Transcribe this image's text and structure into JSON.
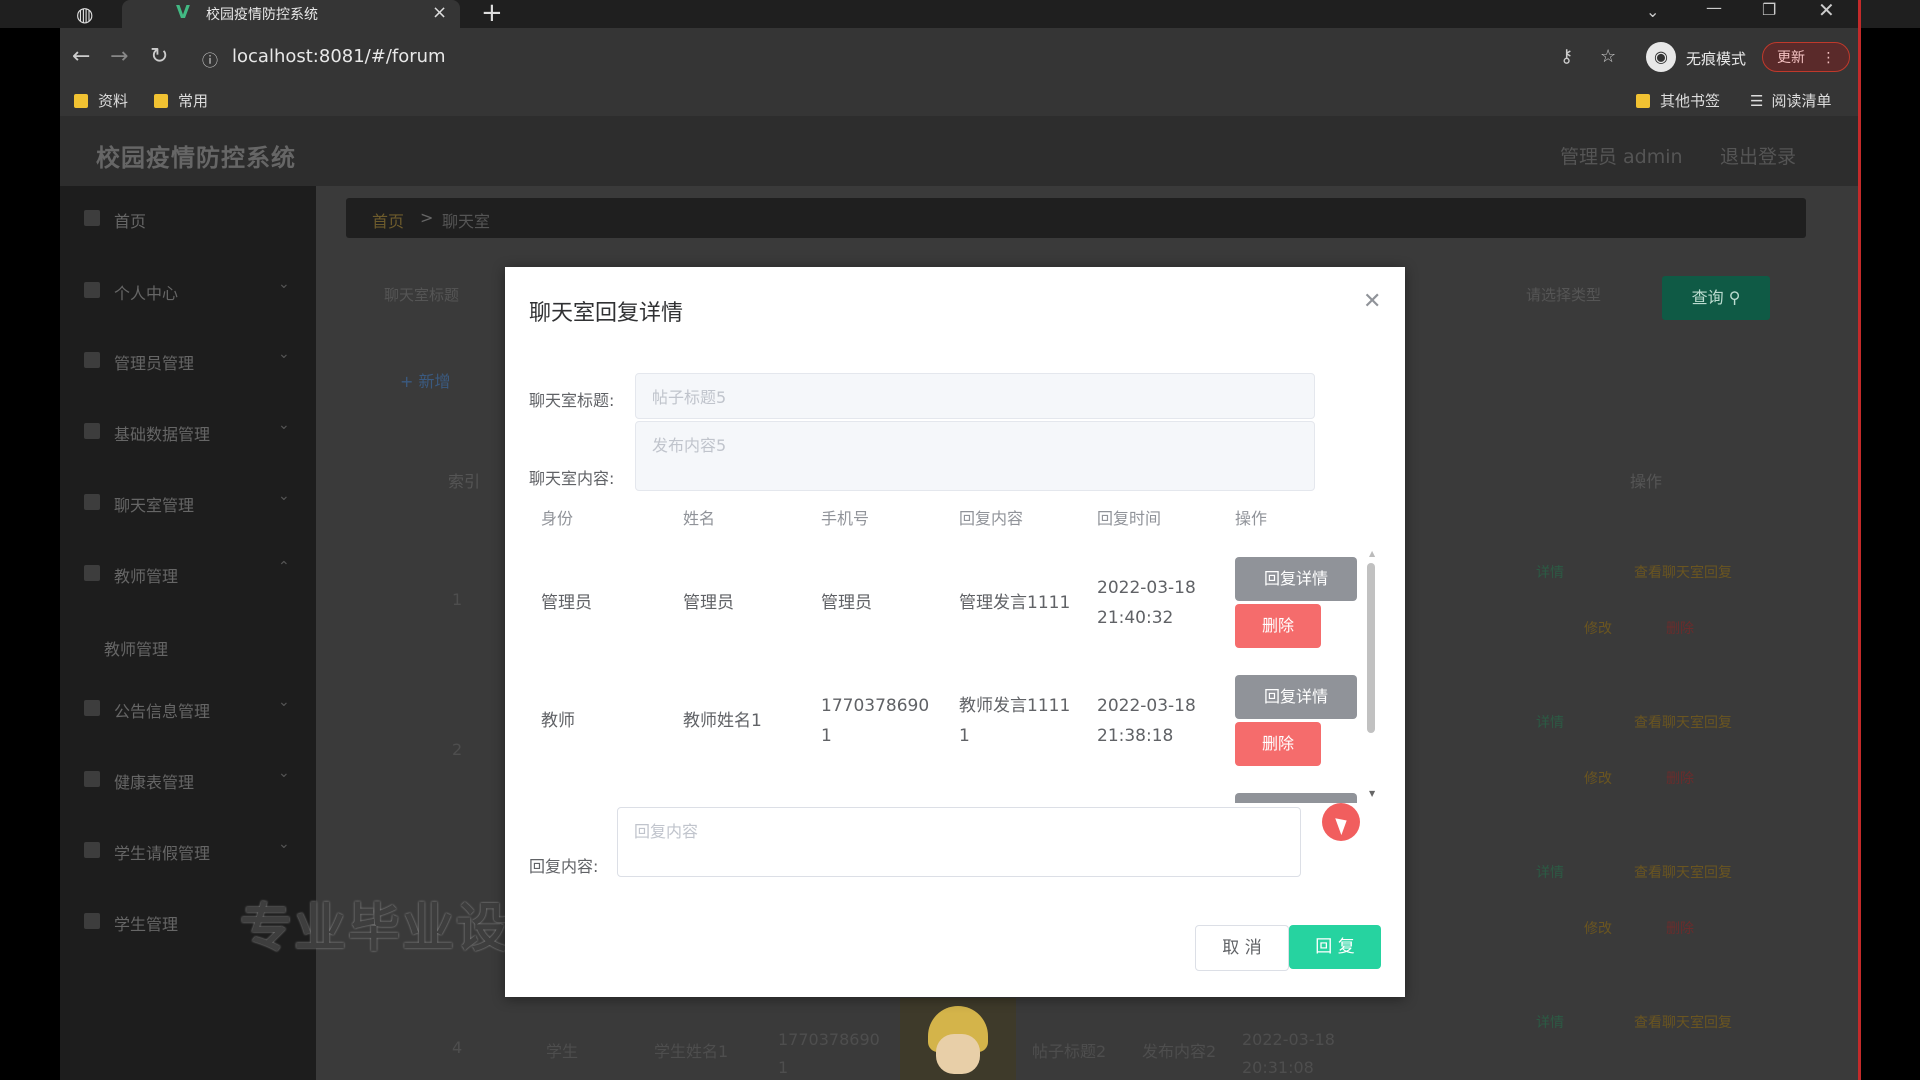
{
  "browser": {
    "tab_title": "校园疫情防控系统",
    "url": "localhost:8081/#/forum",
    "incognito_label": "无痕模式",
    "update_label": "更新",
    "bookmarks": [
      "资料",
      "常用"
    ],
    "other_bookmarks": "其他书签",
    "reading_list": "阅读清单"
  },
  "app": {
    "title": "校园疫情防控系统",
    "user": "管理员 admin",
    "logout": "退出登录"
  },
  "sidebar": {
    "items": [
      {
        "label": "首页",
        "icon": "home-icon",
        "chevron": false
      },
      {
        "label": "个人中心",
        "icon": "user-icon",
        "chevron": true
      },
      {
        "label": "管理员管理",
        "icon": "flag-icon",
        "chevron": true
      },
      {
        "label": "基础数据管理",
        "icon": "send-icon",
        "chevron": true
      },
      {
        "label": "聊天室管理",
        "icon": "chat-icon",
        "chevron": true
      },
      {
        "label": "教师管理",
        "icon": "teacher-icon",
        "chevron": true
      },
      {
        "label": "公告信息管理",
        "icon": "notice-icon",
        "chevron": true
      },
      {
        "label": "健康表管理",
        "icon": "grid-icon",
        "chevron": true
      },
      {
        "label": "学生请假管理",
        "icon": "location-icon",
        "chevron": true
      },
      {
        "label": "学生管理",
        "icon": "student-icon",
        "chevron": false
      }
    ],
    "sub_item": "教师管理"
  },
  "breadcrumb": {
    "home": "首页",
    "separator": ">",
    "current": "聊天室"
  },
  "background": {
    "search_placeholder": "聊天室标题",
    "select_placeholder": "请选择类型",
    "query_button": "查询",
    "add_button": "新增",
    "col_index": "索引",
    "col_ops": "操作",
    "rows": [
      {
        "index": "1"
      },
      {
        "index": "2"
      },
      {
        "index": "4",
        "identity": "学生",
        "name": "学生姓名1",
        "phone": "17703786901",
        "post_title": "帖子标题2",
        "post_content": "发布内容2",
        "time": "2022-03-18 20:31:08"
      }
    ],
    "link_detail": "详情",
    "link_reply": "查看聊天室回复",
    "link_edit": "修改",
    "link_delete": "删除"
  },
  "dialog": {
    "title": "聊天室回复详情",
    "label_title": "聊天室标题:",
    "title_placeholder": "帖子标题5",
    "label_content": "聊天室内容:",
    "content_placeholder": "发布内容5",
    "columns": [
      "身份",
      "姓名",
      "手机号",
      "回复内容",
      "回复时间",
      "操作"
    ],
    "rows": [
      {
        "identity": "管理员",
        "name": "管理员",
        "phone": "管理员",
        "reply": "管理发言1111",
        "time_date": "2022-03-18",
        "time_clock": "21:40:32"
      },
      {
        "identity": "教师",
        "name": "教师姓名1",
        "phone_l1": "1770378690",
        "phone_l2": "1",
        "reply_l1": "教师发言1111",
        "reply_l2": "1",
        "time_date": "2022-03-18",
        "time_clock": "21:38:18"
      }
    ],
    "btn_detail": "回复详情",
    "btn_delete": "删除",
    "label_reply": "回复内容:",
    "reply_placeholder": "回复内容",
    "btn_cancel": "取 消",
    "btn_reply": "回 复"
  },
  "watermark": "专业毕业设计",
  "colors": {
    "reply_button": "#26d3a0",
    "delete_button": "#f56c6c",
    "detail_button": "#909399",
    "query_button": "#0f5a45"
  }
}
